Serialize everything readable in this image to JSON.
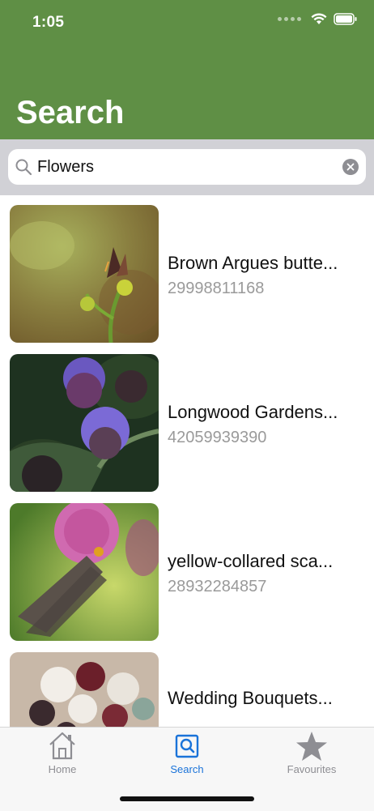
{
  "status": {
    "time": "1:05"
  },
  "header": {
    "title": "Search"
  },
  "search": {
    "value": "Flowers",
    "icon": "search-icon",
    "clear_icon": "clear-icon"
  },
  "results": [
    {
      "title": "Brown Argues butte...",
      "subtitle": "29998811168"
    },
    {
      "title": "Longwood Gardens...",
      "subtitle": "42059939390"
    },
    {
      "title": "yellow-collared sca...",
      "subtitle": "28932284857"
    },
    {
      "title": "Wedding Bouquets...",
      "subtitle": ""
    }
  ],
  "tabs": [
    {
      "label": "Home",
      "icon": "home-icon"
    },
    {
      "label": "Search",
      "icon": "search-tab-icon"
    },
    {
      "label": "Favourites",
      "icon": "star-icon"
    }
  ],
  "colors": {
    "header": "#5f8f45",
    "tab_active": "#1a73d9",
    "tab_inactive": "#8e8e93"
  }
}
